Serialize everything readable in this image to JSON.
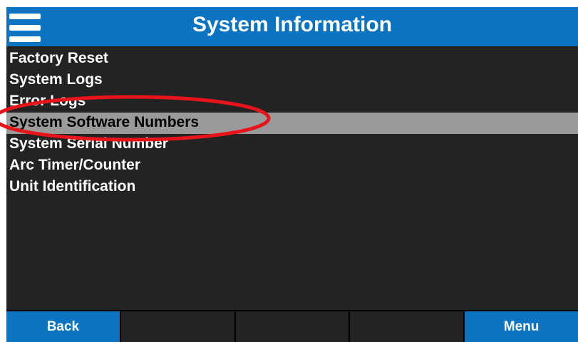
{
  "header": {
    "title": "System Information",
    "menu_icon": "hamburger-menu-icon"
  },
  "menu": {
    "items": [
      {
        "label": "Factory Reset",
        "selected": false
      },
      {
        "label": "System Logs",
        "selected": false
      },
      {
        "label": "Error Logs",
        "selected": false
      },
      {
        "label": "System Software Numbers",
        "selected": true
      },
      {
        "label": "System Serial Number",
        "selected": false
      },
      {
        "label": "Arc Timer/Counter",
        "selected": false
      },
      {
        "label": "Unit Identification",
        "selected": false
      }
    ]
  },
  "footer": {
    "back_label": "Back",
    "menu_label": "Menu"
  },
  "colors": {
    "header_blue": "#0a74c2",
    "background": "#232323",
    "selected_row": "#9a9a9a",
    "annotation_ellipse": "#e8141b"
  }
}
